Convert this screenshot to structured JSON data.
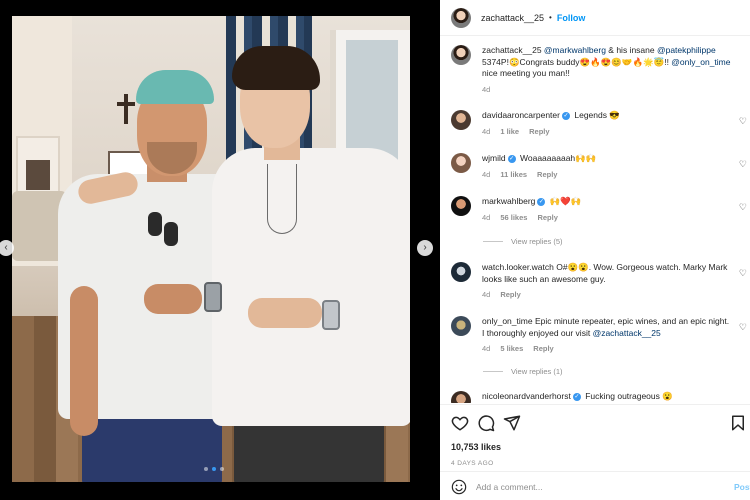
{
  "post": {
    "author": "zachattack__25",
    "separator": "•",
    "follow_label": "Follow"
  },
  "caption": {
    "username": "zachattack__25",
    "text_1": " ",
    "mention_1": "@markwahlberg",
    "text_2": " & his insane ",
    "mention_2": "@patekphilippe",
    "text_3": " 5374P!😳Congrats buddy😍🔥😍😊🤝🔥🌟😇!! ",
    "mention_3": "@only_on_time",
    "text_4": " nice meeting you man!!",
    "age": "4d"
  },
  "comments": [
    {
      "username": "davidaaroncarpenter",
      "verified": true,
      "text": "Legends 😎",
      "age": "4d",
      "likes": "1 like",
      "reply_label": "Reply"
    },
    {
      "username": "wjmild",
      "verified": true,
      "text": "Woaaaaaaaah🙌🙌",
      "age": "4d",
      "likes": "11 likes",
      "reply_label": "Reply"
    },
    {
      "username": "markwahlberg",
      "verified": true,
      "text": "🙌❤️🙌",
      "age": "4d",
      "likes": "56 likes",
      "reply_label": "Reply",
      "view_replies": "View replies (5)"
    },
    {
      "username": "watch.looker.watch",
      "verified": false,
      "text": "O#😮😮. Wow. Gorgeous watch. Marky Mark looks like such an awesome guy.",
      "age": "4d",
      "reply_label": "Reply"
    },
    {
      "username": "only_on_time",
      "verified": false,
      "text": "Epic minute repeater, epic wines, and an epic night. I thoroughly enjoyed our visit ",
      "mention": "@zachattack__25",
      "age": "4d",
      "likes": "5 likes",
      "reply_label": "Reply",
      "view_replies": "View replies (1)"
    },
    {
      "username": "nicoleonardvanderhorst",
      "verified": true,
      "text": "Fucking outrageous 😮"
    }
  ],
  "footer": {
    "likes": "10,753 likes",
    "ago": "4 DAYS AGO",
    "comment_placeholder": "Add a comment...",
    "post_label": "Post"
  },
  "carousel": {
    "count": 3,
    "active": 1
  },
  "colors": {
    "accent": "#0095f6",
    "link": "#00376b",
    "muted": "#8e8e8e"
  }
}
